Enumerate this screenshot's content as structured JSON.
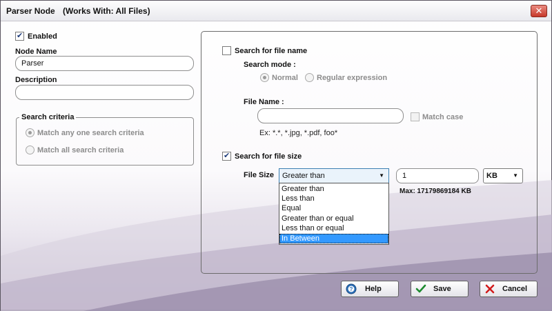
{
  "window": {
    "title": "Parser Node",
    "subtitle": "(Works With: All Files)",
    "close_glyph": "✕"
  },
  "left": {
    "enabled_label": "Enabled",
    "enabled_checked": true,
    "node_name_label": "Node Name",
    "node_name_value": "Parser",
    "description_label": "Description",
    "description_value": "",
    "search_criteria": {
      "title": "Search criteria",
      "options": [
        "Match any one search criteria",
        "Match all search criteria"
      ],
      "selected": 0
    }
  },
  "right": {
    "search_file_name_label": "Search for file name",
    "search_file_name_checked": false,
    "search_mode_label": "Search mode :",
    "search_mode_options": [
      "Normal",
      "Regular expression"
    ],
    "search_mode_selected": 0,
    "file_name_label": "File Name :",
    "file_name_value": "",
    "match_case_label": "Match case",
    "file_name_hint": "Ex: *.*, *.jpg, *.pdf, foo*",
    "search_file_size_label": "Search for file size",
    "search_file_size_checked": true,
    "file_size_label": "File Size",
    "comparison_selected": "Greater than",
    "comparison_options": [
      "Greater than",
      "Less than",
      "Equal",
      "Greater than or equal",
      "Less than or equal",
      "In Between"
    ],
    "highlighted_option": "In Between",
    "size_value": "1",
    "unit_selected": "KB",
    "max_hint": "Max: 17179869184 KB"
  },
  "buttons": {
    "help_label": "Help",
    "save_label": "Save",
    "cancel_label": "Cancel"
  },
  "icons": {
    "help": "help-icon",
    "save": "checkmark-icon",
    "cancel": "cancel-x-icon"
  },
  "colors": {
    "accent": "#3399ff",
    "cancel_red": "#d21b1b",
    "save_green": "#1c8a2e",
    "help_blue": "#2c6fb7"
  }
}
